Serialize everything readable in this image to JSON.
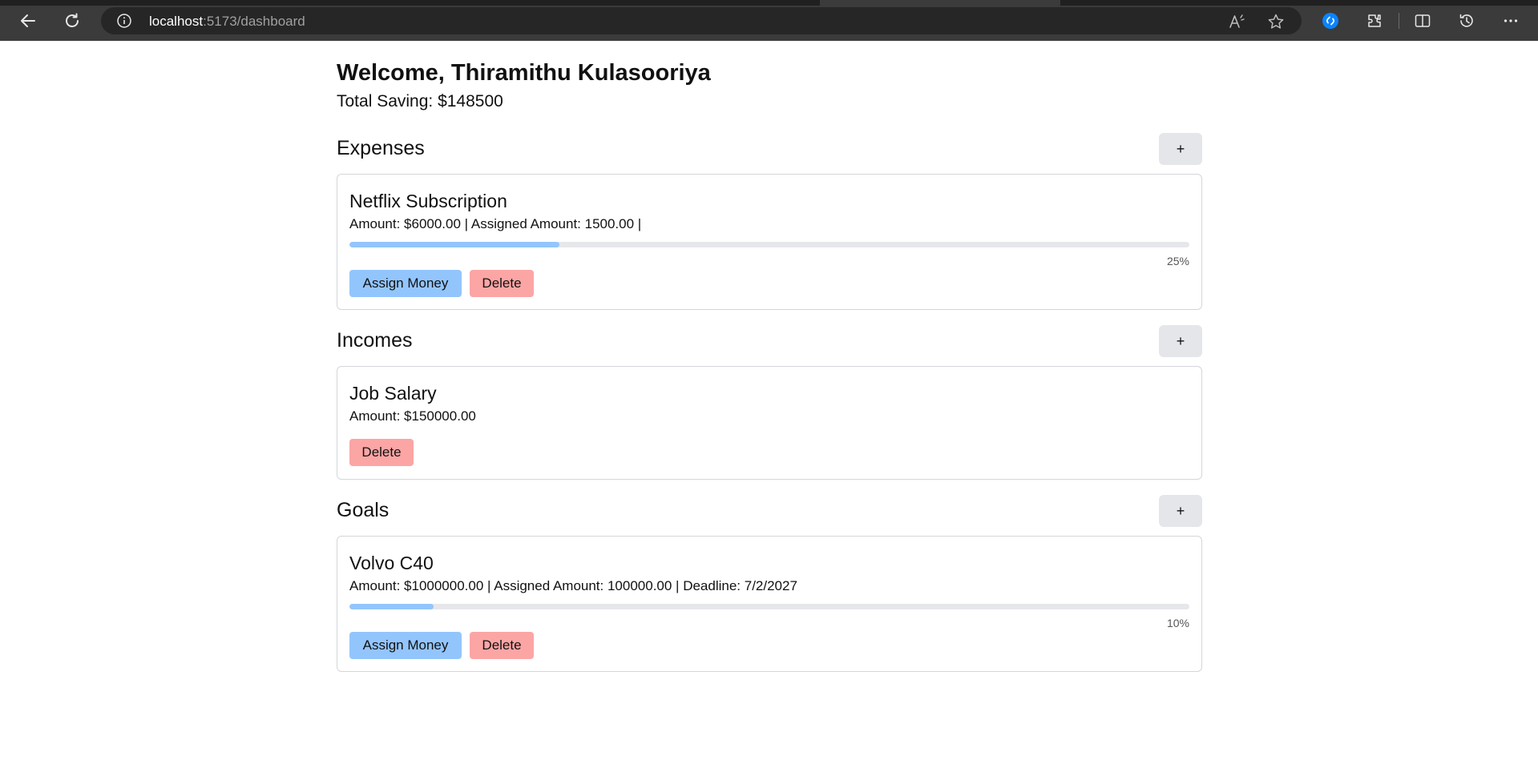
{
  "browser": {
    "url_host": "localhost",
    "url_path": ":5173/dashboard"
  },
  "colors": {
    "progress_fill": "#93c5fd",
    "assign_button": "#93c5fd",
    "delete_button": "#fca5a5",
    "add_button": "#e4e6ea"
  },
  "header": {
    "welcome": "Welcome, Thiramithu Kulasooriya",
    "total_saving": "Total Saving: $148500"
  },
  "expenses": {
    "title": "Expenses",
    "add_label": "+",
    "items": [
      {
        "name": "Netflix Subscription",
        "details": "Amount: $6000.00 | Assigned Amount: 1500.00 |",
        "progress": 0.25,
        "progress_label": "25%",
        "assign_label": "Assign Money",
        "delete_label": "Delete"
      }
    ]
  },
  "incomes": {
    "title": "Incomes",
    "add_label": "+",
    "items": [
      {
        "name": "Job Salary",
        "details": "Amount: $150000.00",
        "delete_label": "Delete"
      }
    ]
  },
  "goals": {
    "title": "Goals",
    "add_label": "+",
    "items": [
      {
        "name": "Volvo C40",
        "details": "Amount: $1000000.00 | Assigned Amount: 100000.00 | Deadline: 7/2/2027",
        "progress": 0.1,
        "progress_label": "10%",
        "assign_label": "Assign Money",
        "delete_label": "Delete"
      }
    ]
  }
}
